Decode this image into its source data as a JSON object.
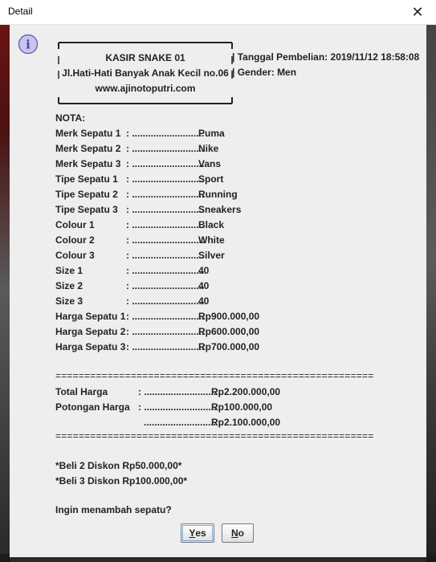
{
  "window": {
    "title": "Detail",
    "close_glyph": "✕"
  },
  "icon": {
    "name": "info-icon",
    "glyph": "i"
  },
  "header": {
    "store_name": "KASIR SNAKE 01",
    "address": "Jl.Hati-Hati Banyak Anak Kecil no.06",
    "website": "www.ajinotoputri.com",
    "border_tick": "|"
  },
  "info": {
    "date_label": "Tanggal Pembelian:",
    "date_value": "2019/11/12 18:58:08",
    "gender_label": "Gender:",
    "gender_value": "Men"
  },
  "nota": {
    "label": "NOTA:",
    "rows": [
      {
        "label": "Merk Sepatu 1",
        "dots": ": ...........................",
        "value": "Puma"
      },
      {
        "label": "Merk Sepatu 2",
        "dots": ": ...........................",
        "value": "Nike"
      },
      {
        "label": "Merk Sepatu 3",
        "dots": ": ...........................",
        "value": "Vans"
      },
      {
        "label": "Tipe Sepatu 1",
        "dots": ": ...........................",
        "value": "Sport"
      },
      {
        "label": "Tipe Sepatu 2",
        "dots": ": ...........................",
        "value": "Running"
      },
      {
        "label": "Tipe Sepatu 3",
        "dots": ": ...........................",
        "value": "Sneakers"
      },
      {
        "label": "Colour 1",
        "dots": ": ...........................",
        "value": "Black"
      },
      {
        "label": "Colour 2",
        "dots": ": ...........................",
        "value": "White"
      },
      {
        "label": "Colour 3",
        "dots": ": ...........................",
        "value": "Silver"
      },
      {
        "label": "Size 1",
        "dots": ": ...........................",
        "value": "40"
      },
      {
        "label": "Size 2",
        "dots": ": ...........................",
        "value": "40"
      },
      {
        "label": "Size 3",
        "dots": ": ...........................",
        "value": "40"
      },
      {
        "label": "Harga Sepatu 1",
        "dots": ": ...........................",
        "value": "Rp900.000,00"
      },
      {
        "label": "Harga Sepatu 2",
        "dots": ": ...........................",
        "value": "Rp600.000,00"
      },
      {
        "label": "Harga Sepatu 3",
        "dots": ": ...........................",
        "value": "Rp700.000,00"
      }
    ]
  },
  "separator": "=======================================================",
  "totals": {
    "total_label": "Total Harga",
    "total_dots": ": ...........................",
    "total_value": "Rp2.200.000,00",
    "discount_label": "Potongan Harga",
    "discount_dots": ": ...........................",
    "discount_value": "Rp100.000,00",
    "final_dots": "...........................",
    "final_value": "Rp2.100.000,00"
  },
  "promo": [
    "*Beli 2 Diskon Rp50.000,00*",
    "*Beli 3 Diskon Rp100.000,00*"
  ],
  "question": "Ingin menambah sepatu?",
  "buttons": {
    "yes": {
      "mnemonic": "Y",
      "rest": "es"
    },
    "no": {
      "mnemonic": "N",
      "rest": "o"
    }
  },
  "colors": {
    "dialog_bg": "#eeeeee",
    "icon_fill": "#c9c6ee",
    "icon_stroke": "#6b67b8"
  }
}
